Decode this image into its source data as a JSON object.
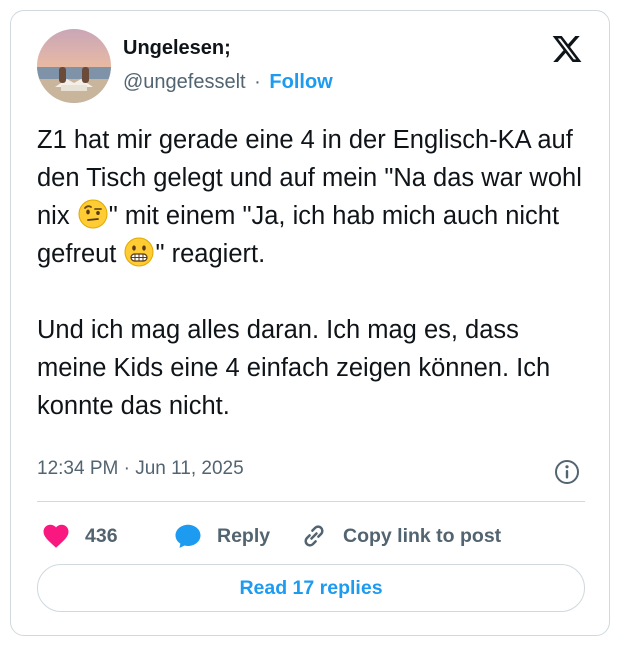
{
  "author": {
    "display_name": "Ungelesen;",
    "handle": "@ungefesselt",
    "separator": "·",
    "follow_label": "Follow",
    "avatar": "avatar-person-reading-on-beach"
  },
  "platform_icon": "x-logo-icon",
  "tweet": {
    "paragraphs": [
      {
        "segments": [
          {
            "text": "Z1 hat mir gerade eine 4 in der Englisch-KA auf den Tisch gelegt und auf mein \"Na das war wohl nix "
          },
          {
            "emoji": "face-with-raised-eyebrow-emoji"
          },
          {
            "text": "\" mit einem \"Ja, ich hab mich auch nicht gefreut "
          },
          {
            "emoji": "grimacing-face-emoji"
          },
          {
            "text": "\" reagiert."
          }
        ]
      },
      {
        "segments": [
          {
            "text": "Und ich mag alles daran. Ich mag es, dass meine Kids eine 4 einfach zeigen können. Ich konnte das nicht."
          }
        ]
      }
    ],
    "timestamp": "12:34 PM · Jun 11, 2025"
  },
  "actions": {
    "like_count": "436",
    "reply_label": "Reply",
    "copy_label": "Copy link to post"
  },
  "read_replies_label": "Read 17 replies",
  "colors": {
    "accent": "#1d9bf0",
    "like": "#f91880",
    "text": "#0f1419",
    "muted": "#536471",
    "border": "#cfd9de"
  }
}
